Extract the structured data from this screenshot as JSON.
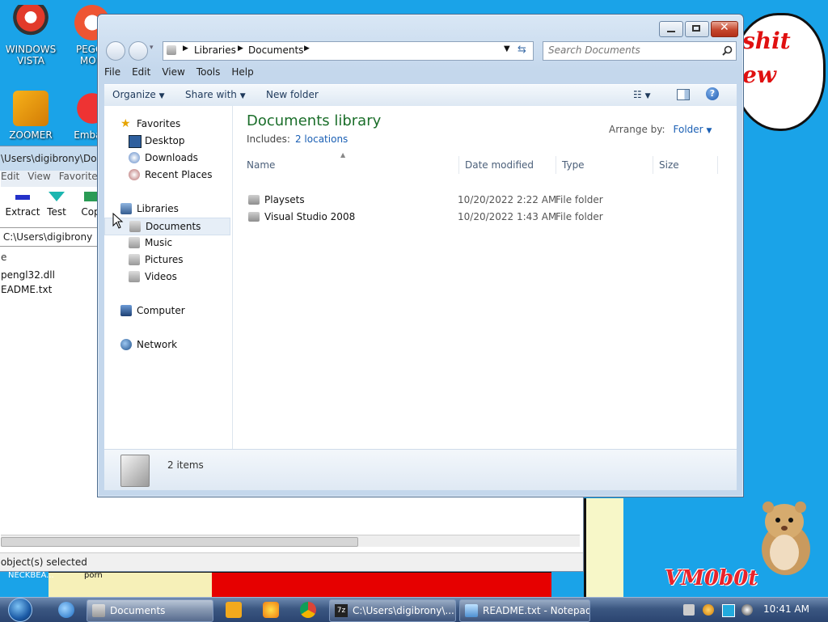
{
  "wallpaper": {
    "bubble_line1": "shit",
    "bubble_line2": "ew",
    "logo_text": "VM0b0t"
  },
  "desktop_icons": [
    {
      "label_line1": "WINDOWS",
      "label_line2": "VISTA"
    },
    {
      "label_line1": "PEGGL",
      "label_line2": "MOM"
    },
    {
      "label_line1": "ZOOMER",
      "label_line2": ""
    },
    {
      "label_line1": "Embarc",
      "label_line2": ""
    }
  ],
  "background_window": {
    "title_path": "\\Users\\digibrony\\Down",
    "menu": [
      "Edit",
      "View",
      "Favorite"
    ],
    "tools": [
      "Extract",
      "Test",
      "Cop"
    ],
    "address": "C:\\Users\\digibrony",
    "column_header": "e",
    "files": [
      "pengl32.dll",
      "EADME.txt"
    ],
    "status": "object(s) selected",
    "wall_label_1": "NECKBEA...",
    "wall_label_2": "porn"
  },
  "explorer": {
    "breadcrumb": [
      "Libraries",
      "Documents"
    ],
    "search_placeholder": "Search Documents",
    "menu": [
      "File",
      "Edit",
      "View",
      "Tools",
      "Help"
    ],
    "commands": {
      "organize": "Organize",
      "share_with": "Share with",
      "new_folder": "New folder"
    },
    "nav": {
      "favorites": "Favorites",
      "favorites_items": [
        "Desktop",
        "Downloads",
        "Recent Places"
      ],
      "libraries": "Libraries",
      "libraries_items": [
        "Documents",
        "Music",
        "Pictures",
        "Videos"
      ],
      "computer": "Computer",
      "network": "Network"
    },
    "library_title": "Documents library",
    "includes_label": "Includes:",
    "includes_link": "2 locations",
    "arrange_label": "Arrange by:",
    "arrange_value": "Folder",
    "columns": [
      "Name",
      "Date modified",
      "Type",
      "Size"
    ],
    "rows": [
      {
        "name": "Playsets",
        "date": "10/20/2022 2:22 AM",
        "type": "File folder",
        "size": ""
      },
      {
        "name": "Visual Studio 2008",
        "date": "10/20/2022 1:43 AM",
        "type": "File folder",
        "size": ""
      }
    ],
    "details_count": "2 items"
  },
  "taskbar": {
    "buttons": [
      "Documents",
      "C:\\Users\\digibrony\\...",
      "README.txt - Notepad"
    ],
    "clock": "10:41 AM"
  },
  "colors": {
    "desktop": "#1aa3e8",
    "library_title": "#1b6e2a",
    "link": "#1a5fb4",
    "close_button": "#c5472d"
  }
}
